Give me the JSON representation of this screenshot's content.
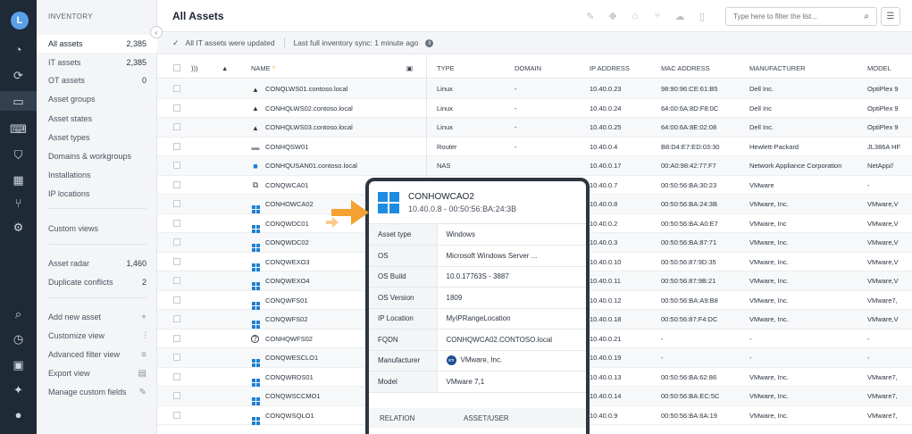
{
  "user": {
    "initial": "L"
  },
  "sidebar": {
    "title": "INVENTORY",
    "items": [
      {
        "label": "All assets",
        "count": "2,385"
      },
      {
        "label": "IT assets",
        "count": "2,385"
      },
      {
        "label": "OT assets",
        "count": "0"
      },
      {
        "label": "Asset groups",
        "count": ""
      },
      {
        "label": "Asset states",
        "count": ""
      },
      {
        "label": "Asset types",
        "count": ""
      },
      {
        "label": "Domains & workgroups",
        "count": ""
      },
      {
        "label": "Installations",
        "count": ""
      },
      {
        "label": "IP locations",
        "count": ""
      },
      {
        "label": "Custom views",
        "count": ""
      },
      {
        "label": "Asset radar",
        "count": "1,460"
      },
      {
        "label": "Duplicate conflicts",
        "count": "2"
      }
    ],
    "actions": [
      {
        "label": "Add new asset",
        "icon": "+"
      },
      {
        "label": "Customize view",
        "icon": "⫶"
      },
      {
        "label": "Advanced filter view",
        "icon": "≡"
      },
      {
        "label": "Export view",
        "icon": "▤"
      },
      {
        "label": "Manage custom fields",
        "icon": "✎"
      }
    ]
  },
  "header": {
    "title": "All Assets",
    "filter_placeholder": "Type here to filter the list..."
  },
  "status": {
    "updated": "All IT assets were updated",
    "sync": "Last full inventory sync: 1 minute ago"
  },
  "table": {
    "columns": [
      "NAME",
      "TYPE",
      "DOMAIN",
      "IP ADDRESS",
      "MAC ADDRESS",
      "MANUFACTURER",
      "MODEL"
    ],
    "sort_indicator": "^",
    "rows": [
      {
        "os": "linux",
        "name": "CONQLWS01.contoso.local",
        "type": "Linux",
        "domain": "-",
        "ip": "10.40.0.23",
        "mac": "98:90:96:CE:61:B5",
        "manufacturer": "Dell Inc.",
        "model": "OptiPlex 9"
      },
      {
        "os": "linux",
        "name": "CONHQLWS02.contoso.local",
        "type": "Linux",
        "domain": "-",
        "ip": "10.40.0.24",
        "mac": "64:00:6A:8D:F8:0C",
        "manufacturer": "Dell Inc",
        "model": "OptiPlex 9"
      },
      {
        "os": "linux",
        "name": "CONHQLWS03.contoso.local",
        "type": "Linux",
        "domain": "-",
        "ip": "10.40.0.25",
        "mac": "64:00:6A:8E:02:08",
        "manufacturer": "Dell Inc.",
        "model": "OptiPlex 9"
      },
      {
        "os": "router",
        "name": "CONHQSW01",
        "type": "Router",
        "domain": "-",
        "ip": "10.40.0.4",
        "mac": "B8:D4:E7:ED:03:30",
        "manufacturer": "Hewlett-Packard",
        "model": "JL386A HF"
      },
      {
        "os": "nas",
        "name": "CONHQUSAN01.contoso.local",
        "type": "NAS",
        "domain": "",
        "ip": "10.40.0.17",
        "mac": "00:A0:98:42:77:F7",
        "manufacturer": "Network Appliance Corporation",
        "model": "NetApp//"
      },
      {
        "os": "vmhost",
        "name": "CONQWCA01",
        "type": "",
        "domain": "",
        "ip": "10.40.0.7",
        "mac": "00:50:56:BA:30:23",
        "manufacturer": "VMware",
        "model": "-"
      },
      {
        "os": "windows",
        "name": "CONHOWCA02",
        "type": "",
        "domain": "",
        "ip": "10.40.0.8",
        "mac": "00:50:56:BA:24:3B",
        "manufacturer": "VMware, Inc.",
        "model": "VMware,V"
      },
      {
        "os": "windows",
        "name": "CONQWDC01",
        "type": "",
        "domain": "",
        "ip": "10.40.0.2",
        "mac": "00:50:56:BA:A0:E7",
        "manufacturer": "VMware, Inc",
        "model": "VMware,V"
      },
      {
        "os": "windows",
        "name": "CONQWDC02",
        "type": "",
        "domain": "",
        "ip": "10.40.0.3",
        "mac": "00:50:56:BA:87:71",
        "manufacturer": "VMware, Inc.",
        "model": "VMware,V"
      },
      {
        "os": "windows",
        "name": "CONQWEXO3",
        "type": "",
        "domain": "",
        "ip": "10.40.0.10",
        "mac": "00:50:56:87:9D:35",
        "manufacturer": "VMware, Inc.",
        "model": "VMware,V"
      },
      {
        "os": "windows",
        "name": "CONQWEXO4",
        "type": "",
        "domain": "",
        "ip": "10.40.0.11",
        "mac": "00:50:56:87:9B:21",
        "manufacturer": "VMware, Inc.",
        "model": "VMware,V"
      },
      {
        "os": "windows",
        "name": "CONQWFS01",
        "type": "",
        "domain": "",
        "ip": "10.40.0.12",
        "mac": "00:50:56:BA:A9:B8",
        "manufacturer": "VMware, Inc.",
        "model": "VMware7,"
      },
      {
        "os": "windows",
        "name": "CONQWFS02",
        "type": "",
        "domain": "",
        "ip": "10.40.0.18",
        "mac": "00:50:56:87:F4:DC",
        "manufacturer": "VMware, Inc.",
        "model": "VMware,V"
      },
      {
        "os": "unknown",
        "name": "CONHQWFS02",
        "type": "",
        "domain": "",
        "ip": "10.40.0.21",
        "mac": "-",
        "manufacturer": "-",
        "model": "-"
      },
      {
        "os": "windows",
        "name": "CONQWESCLO1",
        "type": "",
        "domain": "",
        "ip": "10.40.0.19",
        "mac": "-",
        "manufacturer": "-",
        "model": "-"
      },
      {
        "os": "windows",
        "name": "CONQWRDS01",
        "type": "",
        "domain": "",
        "ip": "10.40.0.13",
        "mac": "00:50:56:BA:62:86",
        "manufacturer": "VMware, Inc.",
        "model": "VMware7,"
      },
      {
        "os": "windows",
        "name": "CONQWSCCMO1",
        "type": "",
        "domain": "",
        "ip": "10.40.0.14",
        "mac": "00:50:56:BA:EC:5C",
        "manufacturer": "VMware, Inc.",
        "model": "VMware7,"
      },
      {
        "os": "windows",
        "name": "CONQWSQLO1",
        "type": "",
        "domain": "",
        "ip": "10.40.0.9",
        "mac": "00:50:56:BA:6A:19",
        "manufacturer": "VMware, Inc.",
        "model": "VMware7,"
      }
    ]
  },
  "popover": {
    "name": "CONHOWCAO2",
    "subtitle": "10.40.0.8 - 00:50:56:BA:24:3B",
    "fields": [
      {
        "key": "Asset type",
        "value": "Windows"
      },
      {
        "key": "OS",
        "value": "Microsoft Windows Server ..."
      },
      {
        "key": "OS Build",
        "value": "10.0.17763S - 3887"
      },
      {
        "key": "OS Version",
        "value": "1809"
      },
      {
        "key": "IP Location",
        "value": "MyIPRangeLocation"
      },
      {
        "key": "FQDN",
        "value": "CONHQWCA02.CONTOSO.local"
      },
      {
        "key": "Manufacturer",
        "value": "VMware, Inc.",
        "badge": "vm"
      },
      {
        "key": "Model",
        "value": "VMware 7,1"
      }
    ],
    "relation_label": "RELATION",
    "asset_user_label": "ASSET/USER"
  },
  "colors": {
    "accent": "#f5a032",
    "rail": "#1f2a37",
    "windows": "#1d8ce0"
  }
}
